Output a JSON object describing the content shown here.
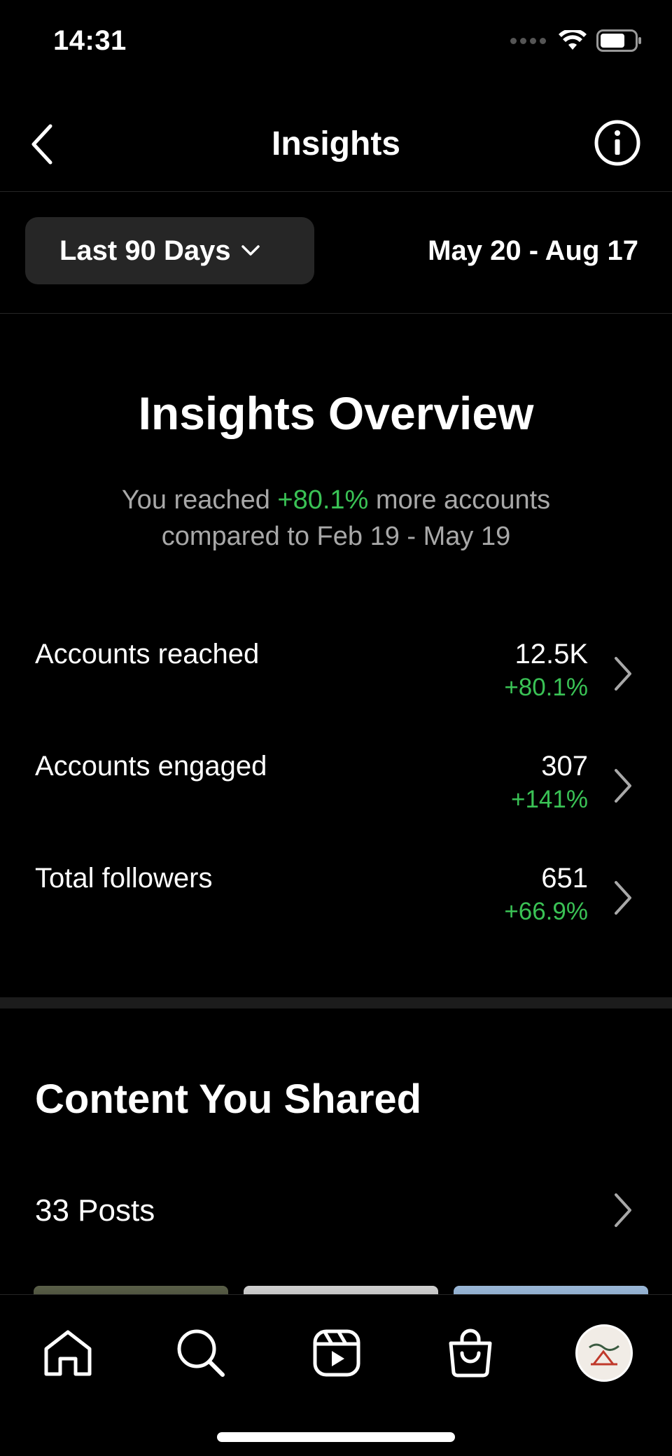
{
  "status_bar": {
    "time": "14:31"
  },
  "header": {
    "title": "Insights"
  },
  "filter": {
    "range_label": "Last 90 Days",
    "date_range": "May 20 - Aug 17"
  },
  "overview": {
    "title": "Insights Overview",
    "subtitle_prefix": "You reached ",
    "subtitle_highlight": "+80.1%",
    "subtitle_suffix": " more accounts compared to Feb 19 - May 19",
    "metrics": [
      {
        "label": "Accounts reached",
        "value": "12.5K",
        "change": "+80.1%"
      },
      {
        "label": "Accounts engaged",
        "value": "307",
        "change": "+141%"
      },
      {
        "label": "Total followers",
        "value": "651",
        "change": "+66.9%"
      }
    ]
  },
  "content": {
    "title": "Content You Shared",
    "posts_label": "33 Posts"
  },
  "colors": {
    "accent_green": "#3ac255",
    "background": "#000000",
    "chip": "#262626"
  },
  "icons": {
    "back": "chevron-left-icon",
    "info": "info-icon",
    "dropdown": "chevron-down-icon",
    "row": "chevron-right-icon",
    "tabs": [
      "home-icon",
      "search-icon",
      "reels-icon",
      "shop-icon",
      "profile-avatar"
    ]
  }
}
